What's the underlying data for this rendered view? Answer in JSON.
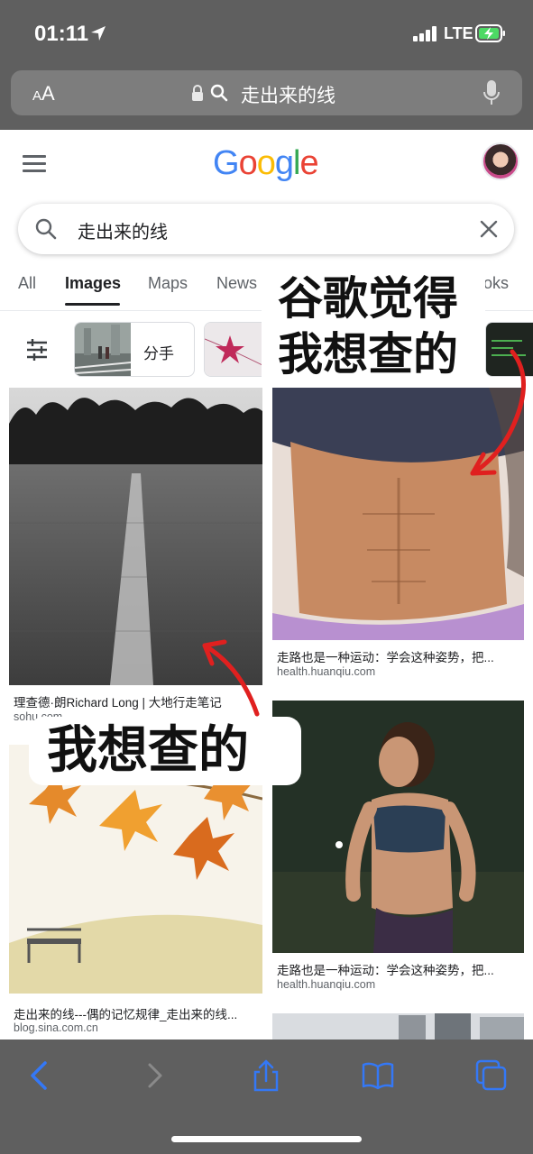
{
  "status_bar": {
    "time": "01:11",
    "network": "LTE"
  },
  "safari": {
    "text_size_label_small": "A",
    "text_size_label_large": "A",
    "address": "走出来的线"
  },
  "google": {
    "logo": [
      "G",
      "o",
      "o",
      "g",
      "l",
      "e"
    ],
    "logo_colors": [
      "#4285F4",
      "#EA4335",
      "#FBBC05",
      "#4285F4",
      "#34A853",
      "#EA4335"
    ],
    "query": "走出来的线",
    "tabs": [
      {
        "label": "All",
        "active": false
      },
      {
        "label": "Images",
        "active": true
      },
      {
        "label": "Maps",
        "active": false
      },
      {
        "label": "News",
        "active": false
      },
      {
        "label": "oks",
        "active": false
      }
    ],
    "chips": [
      {
        "label": "分手"
      }
    ]
  },
  "results": [
    {
      "title": "理查德·朗Richard Long | 大地行走笔记",
      "source": "sohu.com"
    },
    {
      "title": "走路也是一种运动：学会这种姿势，把...",
      "source": "health.huanqiu.com"
    },
    {
      "title": "走出来的线---偶的记忆规律_走出来的线...",
      "source": "blog.sina.com.cn"
    },
    {
      "title": "走路也是一种运动：学会这种姿势，把...",
      "source": "health.huanqiu.com"
    }
  ],
  "annotations": {
    "top_line1": "谷歌觉得",
    "top_line2": "我想查的",
    "middle": "我想查的"
  },
  "colors": {
    "chrome": "#5f5f5f",
    "url_bar": "#7d7d7d",
    "ios_blue": "#3478f6",
    "arrow_red": "#e0201f"
  }
}
